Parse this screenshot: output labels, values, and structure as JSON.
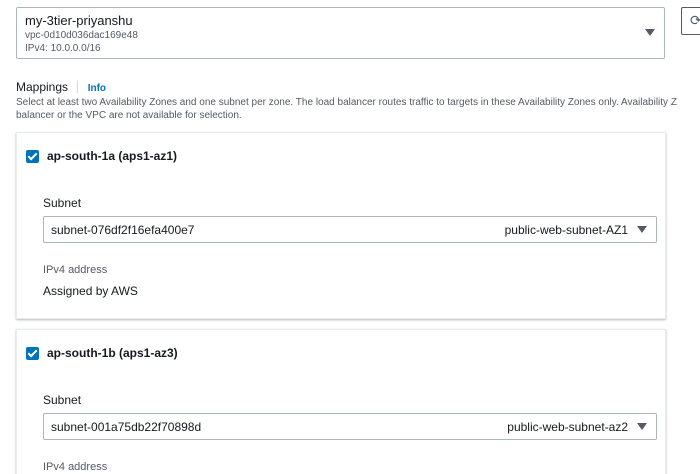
{
  "vpc": {
    "name": "my-3tier-priyanshu",
    "id": "vpc-0d10d036dac169e48",
    "cidr": "IPv4: 10.0.0.0/16"
  },
  "mappings": {
    "title": "Mappings",
    "info": "Info",
    "description_line1": "Select at least two Availability Zones and one subnet per zone. The load balancer routes traffic to targets in these Availability Zones only. Availability Z",
    "description_line2": "balancer or the VPC are not available for selection."
  },
  "zones": [
    {
      "label": "ap-south-1a (aps1-az1)",
      "checked": true,
      "subnet_label": "Subnet",
      "subnet_id": "subnet-076df2f16efa400e7",
      "subnet_name": "public-web-subnet-AZ1",
      "ipv4_label": "IPv4 address",
      "ipv4_value": "Assigned by AWS"
    },
    {
      "label": "ap-south-1b (aps1-az3)",
      "checked": true,
      "subnet_label": "Subnet",
      "subnet_id": "subnet-001a75db22f70898d",
      "subnet_name": "public-web-subnet-az2",
      "ipv4_label": "IPv4 address"
    }
  ],
  "colors": {
    "accent": "#0073bb",
    "border": "#aab7b8",
    "text": "#16191f",
    "muted": "#545b64"
  }
}
